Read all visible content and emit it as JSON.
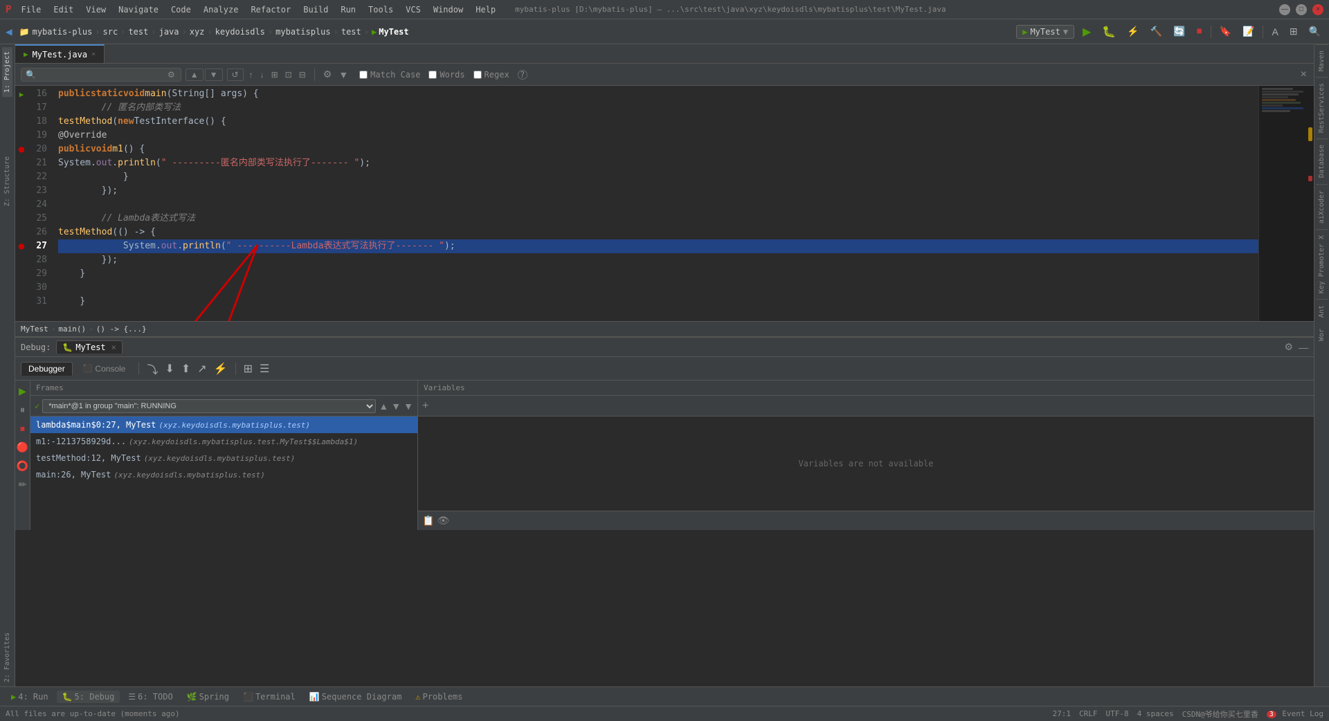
{
  "titlebar": {
    "menu_items": [
      "File",
      "Edit",
      "View",
      "Navigate",
      "Code",
      "Analyze",
      "Refactor",
      "Build",
      "Run",
      "Tools",
      "VCS",
      "Window",
      "Help"
    ],
    "project_path": "mybatis-plus [D:\\mybatis-plus] – ...\\src\\test\\java\\xyz\\keydoisdls\\mybatisplus\\test\\MyTest.java"
  },
  "navbar": {
    "breadcrumbs": [
      "mybatis-plus",
      "src",
      "test",
      "java",
      "xyz",
      "keydoisdls",
      "mybatisplus",
      "test",
      "MyTest"
    ],
    "run_config": "MyTest"
  },
  "tabs": [
    {
      "label": "MyTest.java",
      "active": true
    }
  ],
  "find_bar": {
    "placeholder": "",
    "value": "",
    "match_case_label": "Match Case",
    "words_label": "Words",
    "regex_label": "Regex",
    "match_case_checked": false,
    "words_checked": false,
    "regex_checked": false
  },
  "code": {
    "lines": [
      {
        "num": 16,
        "content": "    public static void main(String[] args) {",
        "type": "normal",
        "has_arrow": true
      },
      {
        "num": 17,
        "content": "        // 匿名内部类写法",
        "type": "comment"
      },
      {
        "num": 18,
        "content": "        testMethod(new TestInterface() {",
        "type": "normal"
      },
      {
        "num": 19,
        "content": "            @Override",
        "type": "normal"
      },
      {
        "num": 20,
        "content": "            public void m1() {",
        "type": "normal",
        "has_marker": true
      },
      {
        "num": 21,
        "content": "                System.out.println(\" ---------匿名内部类写法执行了------- \");",
        "type": "normal"
      },
      {
        "num": 22,
        "content": "            }",
        "type": "normal"
      },
      {
        "num": 23,
        "content": "        });",
        "type": "normal"
      },
      {
        "num": 24,
        "content": "",
        "type": "normal"
      },
      {
        "num": 25,
        "content": "        // Lambda表达式写法",
        "type": "comment"
      },
      {
        "num": 26,
        "content": "        testMethod(() -> {",
        "type": "normal"
      },
      {
        "num": 27,
        "content": "            System.out.println(\" ----------Lambda表达式写法执行了------- \");",
        "type": "highlighted",
        "has_bp": true
      },
      {
        "num": 28,
        "content": "        });",
        "type": "normal"
      },
      {
        "num": 29,
        "content": "    }",
        "type": "normal"
      },
      {
        "num": 30,
        "content": "",
        "type": "normal"
      },
      {
        "num": 31,
        "content": "    }",
        "type": "normal"
      }
    ]
  },
  "breadcrumb_bar": {
    "items": [
      "MyTest",
      "main()",
      "() -> {...}"
    ]
  },
  "debug": {
    "title": "Debug:",
    "session_name": "MyTest",
    "tabs": [
      "Debugger",
      "Console"
    ],
    "active_tab": "Debugger",
    "frames_header": "Frames",
    "vars_header": "Variables",
    "thread_status": "*main*@1 in group \"main\": RUNNING",
    "frames": [
      {
        "method": "lambda$main$0:27, MyTest",
        "class": "(xyz.keydoisdls.mybatisplus.test)",
        "selected": true
      },
      {
        "method": "m1:-1213758929d...",
        "class": "(xyz.keydoisdls.mybatisplus.test.MyTest$$Lambda$1)",
        "selected": false
      },
      {
        "method": "testMethod:12, MyTest",
        "class": "(xyz.keydoisdls.mybatisplus.test)",
        "selected": false
      },
      {
        "method": "main:26, MyTest",
        "class": "(xyz.keydoisdls.mybatisplus.test)",
        "selected": false
      }
    ],
    "vars_empty_msg": "Variables are not available"
  },
  "bottom_tabs": [
    {
      "icon": "▶",
      "label": "4: Run"
    },
    {
      "icon": "🐛",
      "label": "5: Debug"
    },
    {
      "icon": "☰",
      "label": "6: TODO"
    },
    {
      "icon": "🌿",
      "label": "Spring"
    },
    {
      "icon": "⬛",
      "label": "Terminal"
    },
    {
      "icon": "📊",
      "label": "Sequence Diagram"
    },
    {
      "icon": "⚠",
      "label": "Problems"
    }
  ],
  "status_bar": {
    "message": "All files are up-to-date (moments ago)",
    "position": "27:1",
    "line_sep": "CRLF",
    "encoding": "UTF-8",
    "indent": "4 spaces",
    "branch": "CSDN@爷给你买七里香",
    "event_log": "Event Log"
  },
  "right_panels": [
    "Maven",
    "RestServices",
    "Database",
    "aiXcoder",
    "Key Promoter X",
    "Ant",
    "Wor"
  ],
  "left_panels": [
    "1: Project",
    "2: Favorites"
  ],
  "debug_left_icons": {
    "icons": [
      "▶",
      "⏸",
      "⏹",
      "🔴",
      "⭕",
      "✏"
    ]
  },
  "colors": {
    "accent": "#4a88c7",
    "bg_dark": "#2b2b2b",
    "bg_panel": "#3c3f41",
    "highlight_line": "#214283",
    "breakpoint": "#cc0000",
    "green": "#4e9a06",
    "keyword": "#cc7832",
    "string_color": "#6a8759",
    "comment_color": "#808080"
  }
}
